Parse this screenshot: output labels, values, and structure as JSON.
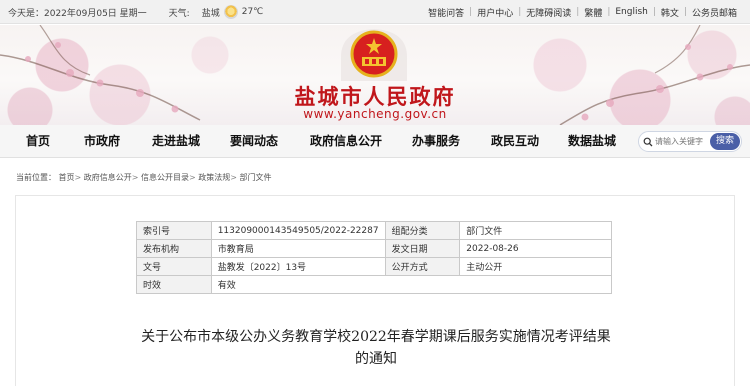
{
  "topbar": {
    "date": "今天是：2022年09月05日 星期一",
    "weather_label": "天气:",
    "city": "盐城",
    "temperature": "27℃",
    "links": [
      "智能问答",
      "用户中心",
      "无障碍阅读",
      "繁體",
      "English",
      "韩文",
      "公务员邮箱"
    ]
  },
  "header": {
    "site_title": "盐城市人民政府",
    "site_url": "www.yancheng.gov.cn"
  },
  "nav": {
    "items": [
      "首页",
      "市政府",
      "走进盐城",
      "要闻动态",
      "政府信息公开",
      "办事服务",
      "政民互动",
      "数据盐城"
    ],
    "search_placeholder": "请输入关键字",
    "search_button": "搜索"
  },
  "breadcrumb": {
    "prefix": "当前位置：",
    "items": [
      "首页",
      "政府信息公开",
      "信息公开目录",
      "政策法规",
      "部门文件"
    ]
  },
  "meta": {
    "rows": [
      [
        "索引号",
        "113209000143549505/2022-22287",
        "组配分类",
        "部门文件"
      ],
      [
        "发布机构",
        "市教育局",
        "发文日期",
        "2022-08-26"
      ],
      [
        "文号",
        "盐教发〔2022〕13号",
        "公开方式",
        "主动公开"
      ],
      [
        "时效",
        "有效"
      ]
    ]
  },
  "document": {
    "title": "关于公布市本级公办义务教育学校2022年春学期课后服务实施情况考评结果的通知"
  },
  "colors": {
    "brand_red": "#c0161b",
    "search_blue": "#4a5fa7"
  }
}
